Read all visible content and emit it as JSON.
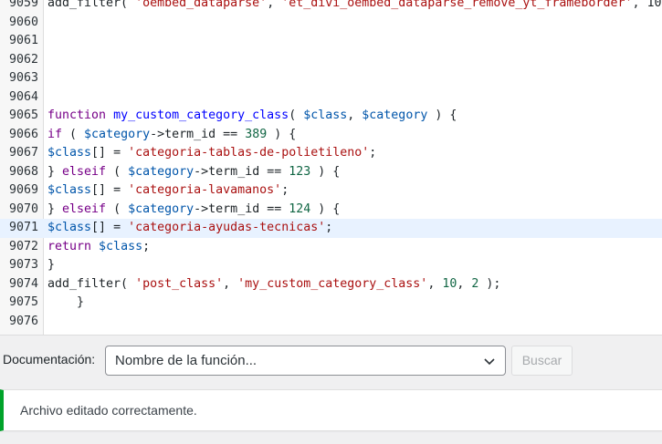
{
  "editor": {
    "lines": [
      {
        "n": "9059",
        "tokens": [
          [
            "plain",
            "add_filter( "
          ],
          [
            "str",
            "'oembed_dataparse'"
          ],
          [
            "plain",
            ", "
          ],
          [
            "str",
            "'et_divi_oembed_dataparse_remove_yt_frameborder'"
          ],
          [
            "plain",
            ", 10"
          ]
        ]
      },
      {
        "n": "9060",
        "tokens": []
      },
      {
        "n": "9061",
        "tokens": []
      },
      {
        "n": "9062",
        "tokens": []
      },
      {
        "n": "9063",
        "tokens": []
      },
      {
        "n": "9064",
        "tokens": []
      },
      {
        "n": "9065",
        "tokens": [
          [
            "kw",
            "function "
          ],
          [
            "def",
            "my_custom_category_class"
          ],
          [
            "plain",
            "( "
          ],
          [
            "var",
            "$class"
          ],
          [
            "plain",
            ", "
          ],
          [
            "var",
            "$category"
          ],
          [
            "plain",
            " ) {"
          ]
        ]
      },
      {
        "n": "9066",
        "tokens": [
          [
            "kw",
            "if"
          ],
          [
            "plain",
            " ( "
          ],
          [
            "var",
            "$category"
          ],
          [
            "plain",
            "->term_id == "
          ],
          [
            "num",
            "389"
          ],
          [
            "plain",
            " ) {"
          ]
        ]
      },
      {
        "n": "9067",
        "tokens": [
          [
            "var",
            "$class"
          ],
          [
            "plain",
            "[] = "
          ],
          [
            "str",
            "'categoria-tablas-de-polietileno'"
          ],
          [
            "plain",
            ";"
          ]
        ]
      },
      {
        "n": "9068",
        "tokens": [
          [
            "plain",
            "} "
          ],
          [
            "kw",
            "elseif"
          ],
          [
            "plain",
            " ( "
          ],
          [
            "var",
            "$category"
          ],
          [
            "plain",
            "->term_id == "
          ],
          [
            "num",
            "123"
          ],
          [
            "plain",
            " ) {"
          ]
        ]
      },
      {
        "n": "9069",
        "tokens": [
          [
            "var",
            "$class"
          ],
          [
            "plain",
            "[] = "
          ],
          [
            "str",
            "'categoria-lavamanos'"
          ],
          [
            "plain",
            ";"
          ]
        ]
      },
      {
        "n": "9070",
        "tokens": [
          [
            "plain",
            "} "
          ],
          [
            "kw",
            "elseif"
          ],
          [
            "plain",
            " ( "
          ],
          [
            "var",
            "$category"
          ],
          [
            "plain",
            "->term_id == "
          ],
          [
            "num",
            "124"
          ],
          [
            "plain",
            " ) {"
          ]
        ]
      },
      {
        "n": "9071",
        "tokens": [
          [
            "var",
            "$class"
          ],
          [
            "plain",
            "[] = "
          ],
          [
            "str",
            "'categoria-ayudas-tecnicas'"
          ],
          [
            "plain",
            ";"
          ]
        ],
        "active": true
      },
      {
        "n": "9072",
        "tokens": [
          [
            "kw",
            "return "
          ],
          [
            "var",
            "$class"
          ],
          [
            "plain",
            ";"
          ]
        ]
      },
      {
        "n": "9073",
        "tokens": [
          [
            "plain",
            "}"
          ]
        ]
      },
      {
        "n": "9074",
        "tokens": [
          [
            "plain",
            "add_filter( "
          ],
          [
            "str",
            "'post_class'"
          ],
          [
            "plain",
            ", "
          ],
          [
            "str",
            "'my_custom_category_class'"
          ],
          [
            "plain",
            ", "
          ],
          [
            "num",
            "10"
          ],
          [
            "plain",
            ", "
          ],
          [
            "num",
            "2"
          ],
          [
            "plain",
            " );"
          ]
        ]
      },
      {
        "n": "9075",
        "tokens": [
          [
            "plain",
            "    }"
          ]
        ]
      },
      {
        "n": "9076",
        "tokens": []
      }
    ]
  },
  "documentation": {
    "label": "Documentación:",
    "select_value": "Nombre de la función...",
    "button_label": "Buscar"
  },
  "notice": {
    "message": "Archivo editado correctamente.",
    "color": "#00a32a"
  }
}
